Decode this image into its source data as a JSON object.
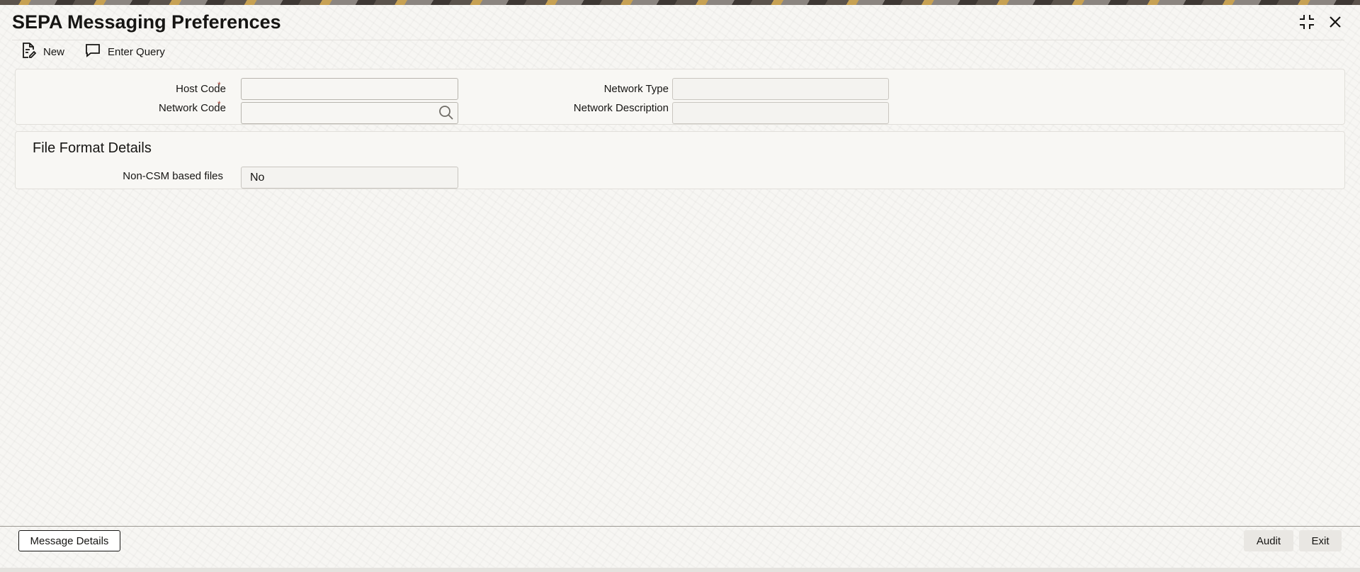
{
  "window": {
    "title": "SEPA Messaging Preferences",
    "icons": [
      "collapse-icon",
      "close-icon"
    ]
  },
  "toolbar": {
    "new_label": "New",
    "enter_query_label": "Enter Query"
  },
  "header_form": {
    "host_code_label": "Host Code",
    "host_code_value": "",
    "network_code_label": "Network Code",
    "network_code_value": "",
    "network_type_label": "Network Type",
    "network_type_value": "",
    "network_description_label": "Network Description",
    "network_description_value": "",
    "required_marker": "*"
  },
  "file_format": {
    "section_title": "File Format Details",
    "non_csm_label": "Non-CSM based files",
    "non_csm_value": "No"
  },
  "footer": {
    "message_details_label": "Message Details",
    "audit_label": "Audit",
    "exit_label": "Exit"
  },
  "colors": {
    "text": "#161513",
    "required_marker": "#9b3a2e",
    "background": "#f7f6f3"
  }
}
